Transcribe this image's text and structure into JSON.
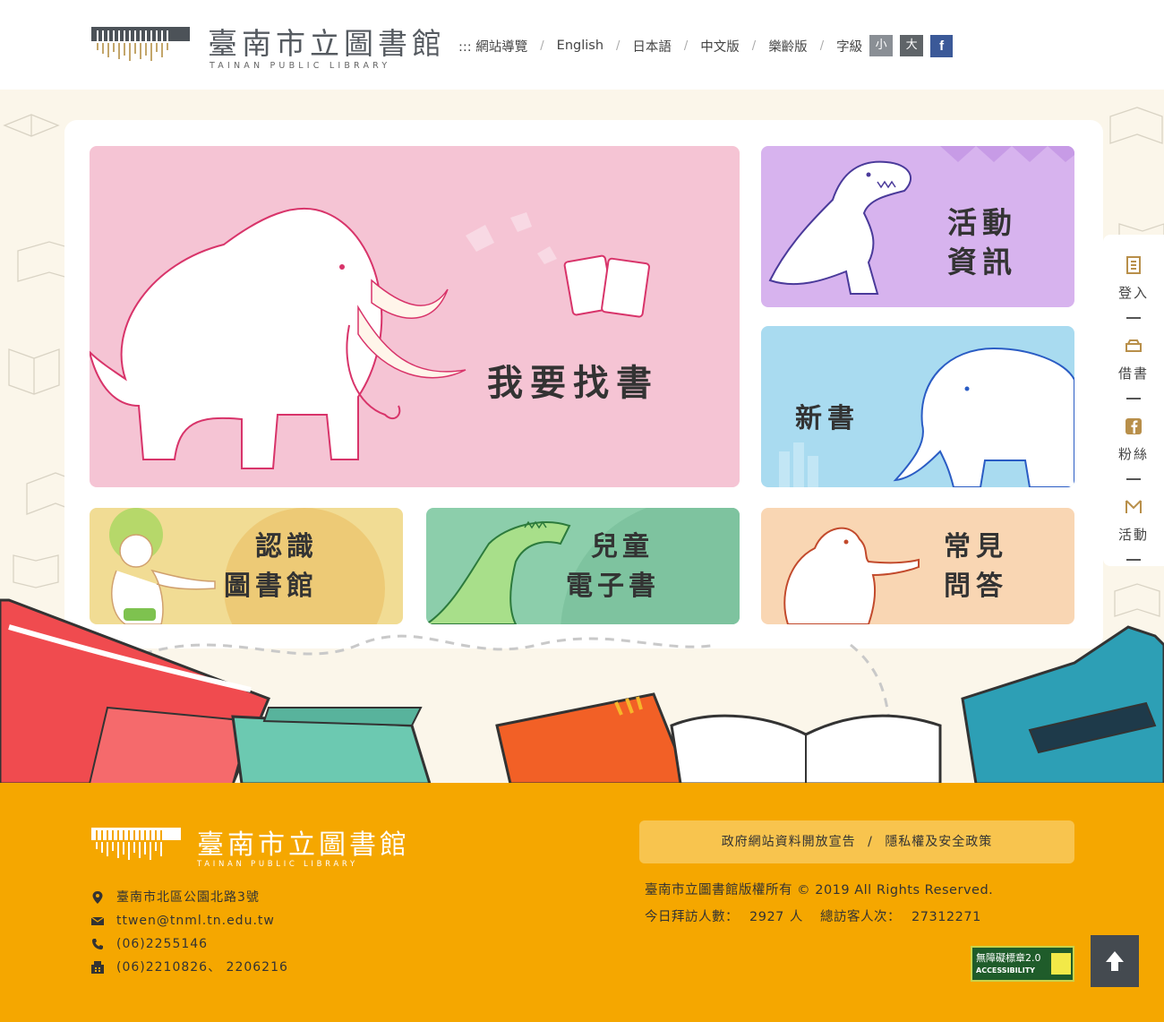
{
  "header": {
    "logo_cn": "臺南市立圖書館",
    "logo_en": "TAINAN PUBLIC LIBRARY",
    "nav": [
      {
        "label": "::: 網站導覽"
      },
      {
        "label": "English"
      },
      {
        "label": "日本語"
      },
      {
        "label": "中文版"
      },
      {
        "label": "樂齡版"
      }
    ],
    "font_size_label": "字級",
    "font_small": "小",
    "font_big": "大",
    "facebook": "f"
  },
  "tiles": {
    "find_book": "我要找書",
    "events_line1": "活動",
    "events_line2": "資訊",
    "new_books": "新書",
    "about_line1": "認識",
    "about_line2": "圖書館",
    "kids_line1": "兒童",
    "kids_line2": "電子書",
    "faq_line1": "常見",
    "faq_line2": "問答"
  },
  "sidenav": [
    {
      "label": "登入",
      "icon": "login-icon"
    },
    {
      "label": "借書",
      "icon": "borrow-icon"
    },
    {
      "label": "粉絲",
      "icon": "facebook-icon"
    },
    {
      "label": "活動",
      "icon": "activity-icon"
    }
  ],
  "footer": {
    "logo_cn": "臺南市立圖書館",
    "logo_en": "TAINAN PUBLIC LIBRARY",
    "address": "臺南市北區公園北路3號",
    "email": "ttwen@tnml.tn.edu.tw",
    "phone": "(06)2255146",
    "fax": "(06)2210826、 2206216",
    "link_open_data": "政府網站資料開放宣告",
    "link_separator": "/",
    "link_privacy": "隱私權及安全政策",
    "copyright": "臺南市立圖書館版權所有 © 2019 All Rights Reserved.",
    "today_label": "今日拜訪人數：",
    "today_count": "2927",
    "person_unit": "人",
    "total_label": "總訪客人次：",
    "total_count": "27312271",
    "badge_line1": "無障礙標章2.0",
    "badge_line2": "ACCESSIBILITY"
  },
  "colors": {
    "footer_bg": "#f5a700",
    "tile_find": "#f5c4d4",
    "tile_events": "#d7b3ee",
    "tile_new": "#a9dbf0",
    "tile_about": "#f1dc94",
    "tile_kids": "#8cceab",
    "tile_faq": "#f9d6b3"
  }
}
